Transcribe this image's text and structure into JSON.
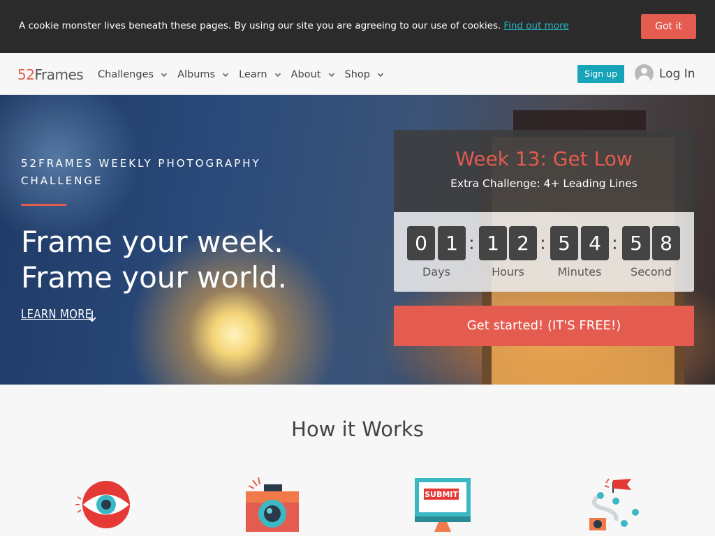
{
  "cookie": {
    "message": "A cookie monster lives beneath these pages. By using our site you are agreeing to our use of cookies.",
    "link": "Find out more",
    "button": "Got it"
  },
  "nav": {
    "logo_number": "52",
    "logo_word": "Frames",
    "items": [
      {
        "label": "Challenges"
      },
      {
        "label": "Albums"
      },
      {
        "label": "Learn"
      },
      {
        "label": "About"
      },
      {
        "label": "Shop"
      }
    ],
    "signup": "Sign up",
    "login": "Log In"
  },
  "hero": {
    "eyebrow": "52FRAMES WEEKLY PHOTOGRAPHY CHALLENGE",
    "tagline_1": "Frame your week.",
    "tagline_2": "Frame your world.",
    "learn_more": "LEARN MORE"
  },
  "challenge": {
    "title": "Week 13: Get Low",
    "extra": "Extra Challenge: 4+ Leading Lines",
    "countdown": {
      "days": [
        "0",
        "1"
      ],
      "hours": [
        "1",
        "2"
      ],
      "minutes": [
        "5",
        "4"
      ],
      "seconds": [
        "5",
        "8"
      ],
      "separator": ":",
      "labels": [
        "Days",
        "Hours",
        "Minutes",
        "Second"
      ]
    },
    "cta": "Get started! (IT'S FREE!)"
  },
  "how": {
    "title": "How it Works",
    "icons": [
      "eye-icon",
      "camera-icon",
      "submit-screen-icon",
      "journey-path-icon"
    ],
    "submit_label": "SUBMIT"
  },
  "colors": {
    "accent": "#e45b4f",
    "teal": "#17a3b8",
    "dark": "#2b2b2b"
  }
}
